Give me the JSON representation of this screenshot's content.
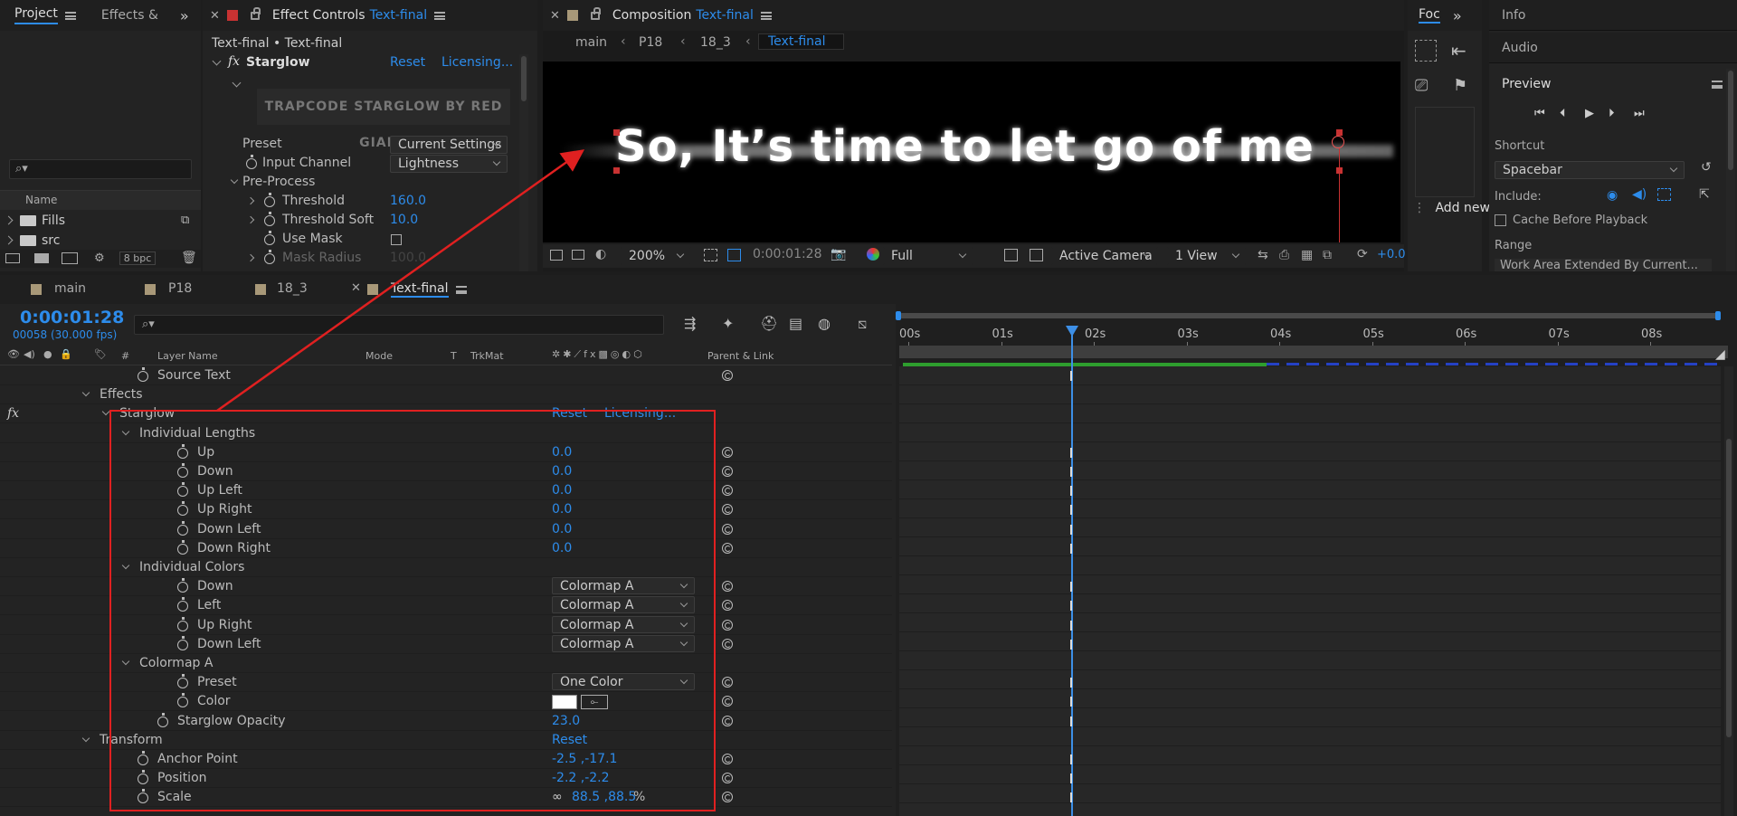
{
  "project_panel": {
    "tab_project": "Project",
    "tab_effects": "Effects &",
    "column_name": "Name",
    "items": [
      {
        "label": "Fills"
      },
      {
        "label": "src"
      }
    ],
    "bpc": "8 bpc"
  },
  "effect_controls": {
    "title": "Effect Controls",
    "title_layer": "Text-final",
    "breadcrumb": "Text-final • Text-final",
    "effect_name": "Starglow",
    "reset": "Reset",
    "licensing": "Licensing...",
    "banner": "TRAPCODE STARGLOW BY RED GIANT",
    "rows": [
      {
        "label": "Preset",
        "value": "Current Settings",
        "kind": "select"
      },
      {
        "label": "Input Channel",
        "value": "Lightness",
        "kind": "select"
      },
      {
        "label": "Pre-Process",
        "value": "",
        "kind": "group"
      },
      {
        "label": "Threshold",
        "value": "160.0",
        "kind": "num"
      },
      {
        "label": "Threshold Soft",
        "value": "10.0",
        "kind": "num"
      },
      {
        "label": "Use Mask",
        "value": "",
        "kind": "check"
      },
      {
        "label": "Mask Radius",
        "value": "100.0",
        "kind": "dim"
      }
    ]
  },
  "composition": {
    "title": "Composition",
    "title_layer": "Text-final",
    "breadcrumbs": [
      "main",
      "P18",
      "18_3",
      "Text-final"
    ],
    "canvas_text": "So, It’s time to let go of me",
    "toolbar": {
      "zoom": "200%",
      "timecode": "0:00:01:28",
      "resolution": "Full",
      "camera": "Active Camera",
      "views": "1 View",
      "exposure": "+0.0"
    }
  },
  "right_panels": {
    "focus_tab": "Foc",
    "info": "Info",
    "audio": "Audio",
    "preview": "Preview",
    "shortcut_label": "Shortcut",
    "shortcut_value": "Spacebar",
    "include_label": "Include:",
    "cache_label": "Cache Before Playback",
    "range_label": "Range",
    "range_value": "Work Area Extended By Current...",
    "add_new": "Add new"
  },
  "timeline": {
    "tabs": [
      "main",
      "P18",
      "18_3",
      "Text-final"
    ],
    "timecode": "0:00:01:28",
    "frames": "00058 (30.000 fps)",
    "columns": {
      "hash": "#",
      "layer_name": "Layer Name",
      "mode": "Mode",
      "t": "T",
      "trkmat": "TrkMat",
      "parent": "Parent & Link"
    },
    "ruler": [
      "00s",
      "01s",
      "02s",
      "03s",
      "04s",
      "05s",
      "06s",
      "07s",
      "08s"
    ],
    "rows": [
      {
        "indent": 0,
        "twirl": "none",
        "sw": true,
        "label": "Source Text",
        "value": "",
        "kind": "text",
        "spiral": true
      },
      {
        "indent": -1,
        "twirl": "open",
        "sw": false,
        "label": "Effects",
        "value": "",
        "kind": "text",
        "spiral": false
      },
      {
        "indent": 0,
        "twirl": "open",
        "sw": false,
        "label": "Starglow",
        "value": "Reset",
        "value2": "Licensing...",
        "kind": "reset",
        "spiral": false,
        "fx": true
      },
      {
        "indent": 1,
        "twirl": "open",
        "sw": false,
        "label": "Individual Lengths",
        "value": "",
        "kind": "text",
        "spiral": false
      },
      {
        "indent": 2,
        "twirl": "none",
        "sw": true,
        "label": "Up",
        "value": "0.0",
        "kind": "num",
        "spiral": true
      },
      {
        "indent": 2,
        "twirl": "none",
        "sw": true,
        "label": "Down",
        "value": "0.0",
        "kind": "num",
        "spiral": true
      },
      {
        "indent": 2,
        "twirl": "none",
        "sw": true,
        "label": "Up Left",
        "value": "0.0",
        "kind": "num",
        "spiral": true
      },
      {
        "indent": 2,
        "twirl": "none",
        "sw": true,
        "label": "Up Right",
        "value": "0.0",
        "kind": "num",
        "spiral": true
      },
      {
        "indent": 2,
        "twirl": "none",
        "sw": true,
        "label": "Down Left",
        "value": "0.0",
        "kind": "num",
        "spiral": true
      },
      {
        "indent": 2,
        "twirl": "none",
        "sw": true,
        "label": "Down Right",
        "value": "0.0",
        "kind": "num",
        "spiral": true
      },
      {
        "indent": 1,
        "twirl": "open",
        "sw": false,
        "label": "Individual Colors",
        "value": "",
        "kind": "text",
        "spiral": false
      },
      {
        "indent": 2,
        "twirl": "none",
        "sw": true,
        "label": "Down",
        "value": "Colormap A",
        "kind": "select",
        "spiral": true
      },
      {
        "indent": 2,
        "twirl": "none",
        "sw": true,
        "label": "Left",
        "value": "Colormap A",
        "kind": "select",
        "spiral": true
      },
      {
        "indent": 2,
        "twirl": "none",
        "sw": true,
        "label": "Up Right",
        "value": "Colormap A",
        "kind": "select",
        "spiral": true
      },
      {
        "indent": 2,
        "twirl": "none",
        "sw": true,
        "label": "Down Left",
        "value": "Colormap A",
        "kind": "select",
        "spiral": true
      },
      {
        "indent": 1,
        "twirl": "open",
        "sw": false,
        "label": "Colormap A",
        "value": "",
        "kind": "text",
        "spiral": false
      },
      {
        "indent": 2,
        "twirl": "none",
        "sw": true,
        "label": "Preset",
        "value": "One Color",
        "kind": "select",
        "spiral": true
      },
      {
        "indent": 2,
        "twirl": "none",
        "sw": true,
        "label": "Color",
        "value": "",
        "kind": "color",
        "spiral": true
      },
      {
        "indent": 1,
        "twirl": "none",
        "sw": true,
        "label": "Starglow Opacity",
        "value": "23.0",
        "kind": "num",
        "spiral": true
      },
      {
        "indent": -1,
        "twirl": "open",
        "sw": false,
        "label": "Transform",
        "value": "Reset",
        "kind": "reset",
        "spiral": false
      },
      {
        "indent": 0,
        "twirl": "none",
        "sw": true,
        "label": "Anchor Point",
        "value": "-2.5 ,-17.1",
        "kind": "num",
        "spiral": true
      },
      {
        "indent": 0,
        "twirl": "none",
        "sw": true,
        "label": "Position",
        "value": "-2.2 ,-2.2",
        "kind": "num",
        "spiral": true
      },
      {
        "indent": 0,
        "twirl": "none",
        "sw": true,
        "label": "Scale",
        "value": "88.5 ,88.5",
        "unit": "%",
        "kind": "scale",
        "spiral": true
      }
    ]
  },
  "colors": {
    "accent": "#2d8ceb",
    "annotation": "#e02020",
    "work_area": "#2e9e2e",
    "layer_bar": "#2541c4"
  }
}
